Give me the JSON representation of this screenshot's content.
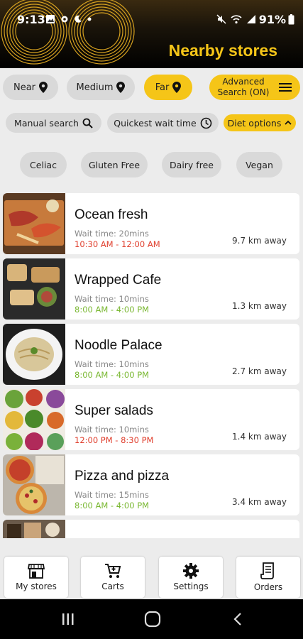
{
  "status_bar": {
    "time": "9:13",
    "battery": "91%"
  },
  "header": {
    "title": "Nearby stores"
  },
  "distance_filters": [
    {
      "label": "Near",
      "icon": "location-pin-icon",
      "active": false
    },
    {
      "label": "Medium",
      "icon": "location-pin-icon",
      "active": false
    },
    {
      "label": "Far",
      "icon": "location-pin-icon",
      "active": true
    }
  ],
  "advanced_search": {
    "label_line1": "Advanced",
    "label_line2": "Search (ON)",
    "icon": "menu-icon"
  },
  "search_options": {
    "manual": {
      "label": "Manual search",
      "icon": "search-icon"
    },
    "quickest": {
      "label": "Quickest wait time",
      "icon": "clock-icon"
    },
    "diet": {
      "label": "Diet options",
      "icon": "chevron-up-icon"
    }
  },
  "diet_options": [
    "Celiac",
    "Gluten Free",
    "Dairy free",
    "Vegan"
  ],
  "stores": [
    {
      "name": "Ocean fresh",
      "wait": "Wait time: 20mins",
      "hours": "10:30 AM - 12:00 AM",
      "status": "closed",
      "distance": "9.7 km away"
    },
    {
      "name": "Wrapped Cafe",
      "wait": "Wait time: 10mins",
      "hours": "8:00 AM - 4:00 PM",
      "status": "open",
      "distance": "1.3 km away"
    },
    {
      "name": "Noodle Palace",
      "wait": "Wait time: 10mins",
      "hours": "8:00 AM - 4:00 PM",
      "status": "open",
      "distance": "2.7 km away"
    },
    {
      "name": "Super salads",
      "wait": "Wait time: 10mins",
      "hours": "12:00 PM - 8:30 PM",
      "status": "closed",
      "distance": "1.4 km away"
    },
    {
      "name": "Pizza and pizza",
      "wait": "Wait time: 15mins",
      "hours": "8:00 AM - 4:00 PM",
      "status": "open",
      "distance": "3.4 km away"
    }
  ],
  "bottom_nav": [
    {
      "label": "My stores",
      "icon": "store-icon"
    },
    {
      "label": "Carts",
      "icon": "cart-icon"
    },
    {
      "label": "Settings",
      "icon": "gear-icon"
    },
    {
      "label": "Orders",
      "icon": "receipt-icon"
    }
  ],
  "colors": {
    "accent": "#f5c518",
    "closed": "#e0402f",
    "open": "#7ab832",
    "pill": "#d9d9d9"
  }
}
